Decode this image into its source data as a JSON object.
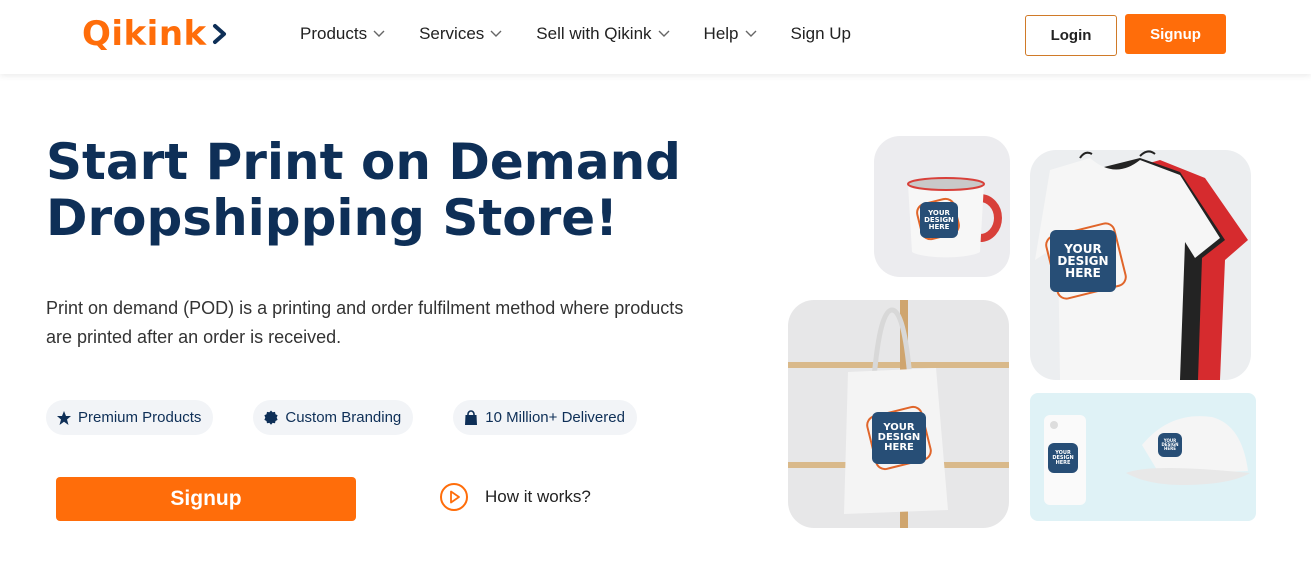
{
  "brand": {
    "name": "Qikink",
    "accent": "#ff6d0a",
    "navy": "#0e2f57"
  },
  "nav": {
    "items": [
      {
        "label": "Products",
        "dropdown": true
      },
      {
        "label": "Services",
        "dropdown": true
      },
      {
        "label": "Sell with Qikink",
        "dropdown": true
      },
      {
        "label": "Help",
        "dropdown": true
      },
      {
        "label": "Sign Up",
        "dropdown": false
      }
    ],
    "login_label": "Login",
    "signup_label": "Signup"
  },
  "hero": {
    "title_line1": "Start Print on Demand",
    "title_line2": "Dropshipping Store!",
    "description": "Print on demand (POD) is a printing and order fulfilment method where products are printed after an order is received.",
    "chips": [
      {
        "icon": "star-icon",
        "label": "Premium Products"
      },
      {
        "icon": "badge-icon",
        "label": "Custom Branding"
      },
      {
        "icon": "bag-icon",
        "label": "10 Million+ Delivered"
      }
    ],
    "signup_label": "Signup",
    "how_label": "How it works?"
  },
  "products": {
    "design_text": "YOUR DESIGN HERE",
    "items": [
      "mug",
      "t-shirts",
      "tote-bag",
      "phone-case-and-cap"
    ]
  }
}
